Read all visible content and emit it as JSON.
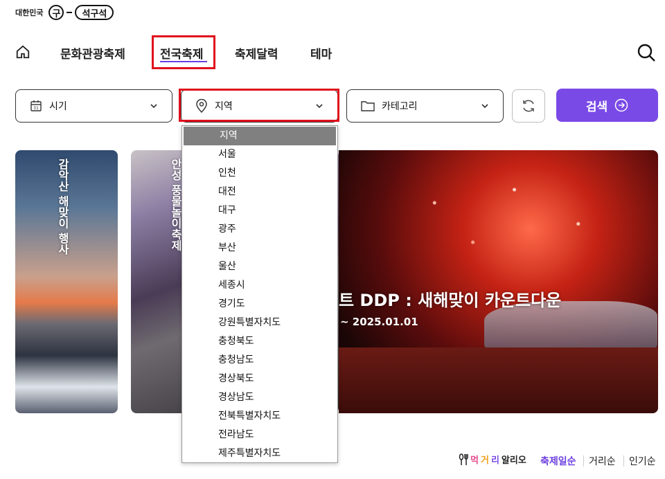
{
  "header": {
    "logo_small": "대한민국",
    "logo_circle": "구",
    "logo_pill": "석구석"
  },
  "nav": {
    "items": [
      "문화관광축제",
      "전국축제",
      "축제달력",
      "테마"
    ],
    "active": "전국축제"
  },
  "filters": {
    "period": "시기",
    "region": "지역",
    "category": "카테고리",
    "search_button": "검색"
  },
  "dropdown": {
    "selected": "지역",
    "options": [
      "지역",
      "서울",
      "인천",
      "대전",
      "대구",
      "광주",
      "부산",
      "울산",
      "세종시",
      "경기도",
      "강원특별자치도",
      "충청북도",
      "충청남도",
      "경상북도",
      "경상남도",
      "전북특별자치도",
      "전라남도",
      "제주특별자치도"
    ]
  },
  "cards": [
    {
      "title": "감악산 해맞이 행사"
    },
    {
      "title": "안성 풍물놀이축제"
    },
    {
      "title": "트 DDP : 새해맞이 카운트다운",
      "date": "~ 2025.01.01"
    }
  ],
  "sort": {
    "logo": [
      "먹",
      "거",
      "리",
      "알리오"
    ],
    "options": [
      "축제일순",
      "거리순",
      "인기순"
    ],
    "active": "축제일순"
  },
  "colors": {
    "accent": "#7a4ae6",
    "highlight_box": "#e0101c"
  }
}
